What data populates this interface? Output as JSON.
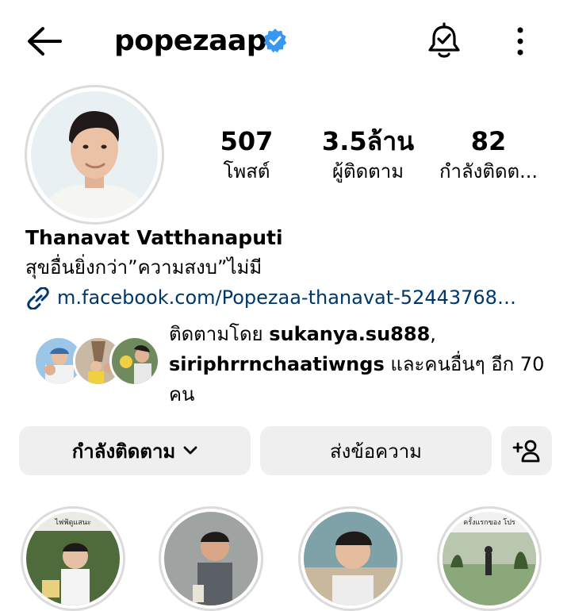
{
  "header": {
    "username": "popezaap",
    "accent": "#3897f0"
  },
  "stats": {
    "posts_count": "507",
    "posts_label": "โพสต์",
    "followers_count": "3.5ล้าน",
    "followers_label": "ผู้ติดตาม",
    "following_count": "82",
    "following_label": "กำลังติดต..."
  },
  "bio": {
    "full_name": "Thanavat Vatthanaputi",
    "text": "สุขอื่นยิ่งกว่า”ความสงบ”ไม่มี",
    "link": "m.facebook.com/Popezaa-thanavat-52443768…",
    "link_color": "#00376b"
  },
  "mutual": {
    "prefix": "ติดตามโดย ",
    "user1": "sukanya.su888",
    "sep": ", ",
    "user2": "siriphrrnchaatiwngs",
    "suffix": " และคนอื่นๆ อีก 70 คน"
  },
  "buttons": {
    "following_label": "กำลังติดตาม",
    "message_label": "ส่งข้อความ"
  },
  "highlights": {
    "h1_caption": "ไฟฟ้ดูแสนะ",
    "h4_caption": "ครั้งแรกของ โปร"
  },
  "icons": {
    "back": "arrow-left-icon",
    "verified": "verified-badge-icon",
    "bell": "bell-check-icon",
    "more": "more-vertical-icon",
    "link": "link-icon",
    "chevron": "chevron-down-icon",
    "add_user": "add-user-icon"
  }
}
